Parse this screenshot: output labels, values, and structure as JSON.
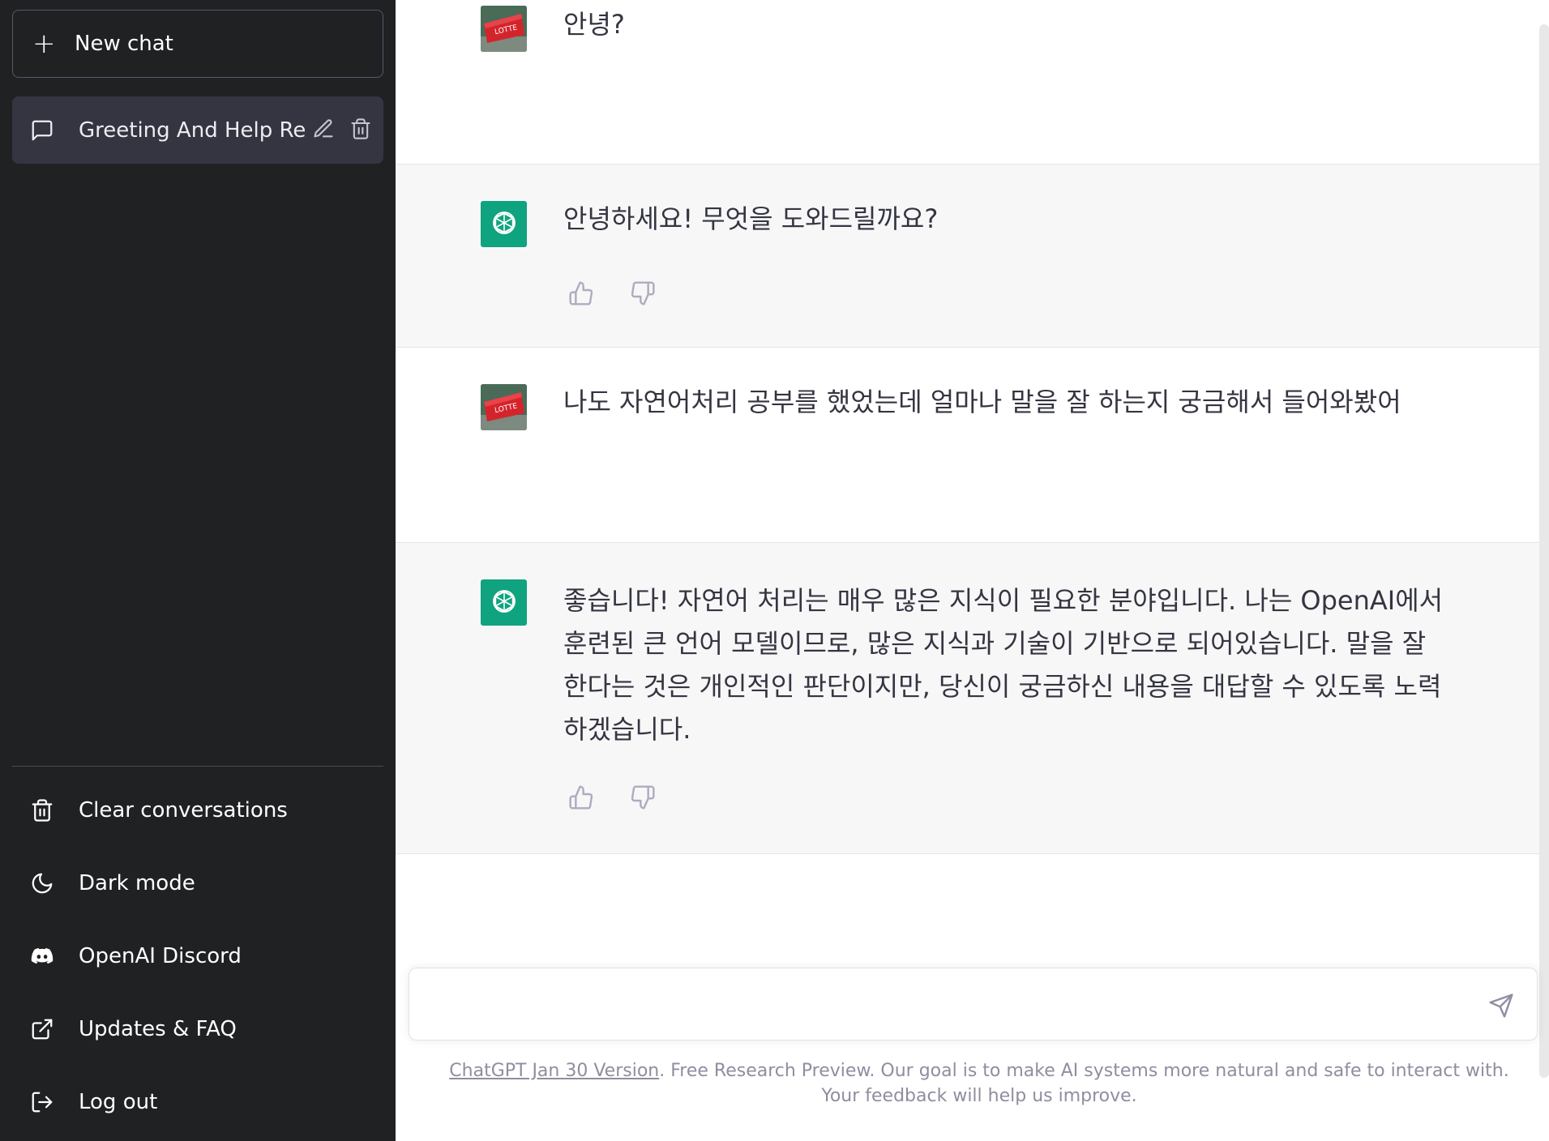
{
  "sidebar": {
    "new_chat_label": "New chat",
    "conversation": {
      "title": "Greeting And Help Re"
    },
    "menu": [
      {
        "label": "Clear conversations",
        "icon": "trash-icon"
      },
      {
        "label": "Dark mode",
        "icon": "moon-icon"
      },
      {
        "label": "OpenAI Discord",
        "icon": "discord-icon"
      },
      {
        "label": "Updates & FAQ",
        "icon": "external-link-icon"
      },
      {
        "label": "Log out",
        "icon": "logout-icon"
      }
    ]
  },
  "messages": [
    {
      "role": "user",
      "text": "안녕?"
    },
    {
      "role": "assistant",
      "text": "안녕하세요! 무엇을 도와드릴까요?"
    },
    {
      "role": "user",
      "text": "나도 자연어처리 공부를 했었는데 얼마나 말을 잘 하는지 궁금해서 들어와봤어"
    },
    {
      "role": "assistant",
      "text": "좋습니다! 자연어 처리는 매우 많은 지식이 필요한 분야입니다. 나는 OpenAI에서 훈련된 큰 언어 모델이므로, 많은 지식과 기술이 기반으로 되어있습니다. 말을 잘 한다는 것은 개인적인 판단이지만, 당신이 궁금하신 내용을 대답할 수 있도록 노력하겠습니다."
    }
  ],
  "composer": {
    "placeholder": ""
  },
  "footer": {
    "version_link": "ChatGPT Jan 30 Version",
    "text": ". Free Research Preview. Our goal is to make AI systems more natural and safe to interact with. Your feedback will help us improve."
  },
  "colors": {
    "sidebar_bg": "#202123",
    "active_conv_bg": "#343541",
    "assistant_bg": "#f7f7f8",
    "brand_green": "#10a37f"
  }
}
